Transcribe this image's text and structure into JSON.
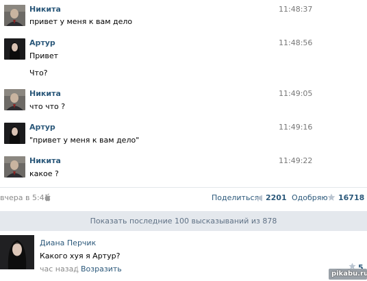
{
  "messages": [
    {
      "author": "Никита",
      "time": "11:48:37",
      "lines": [
        "привет у меня к вам дело"
      ],
      "avatar": "nikita"
    },
    {
      "author": "Артур",
      "time": "11:48:56",
      "lines": [
        "Привет",
        "Что?"
      ],
      "avatar": "artur"
    },
    {
      "author": "Никита",
      "time": "11:49:05",
      "lines": [
        "что что ?"
      ],
      "avatar": "nikita"
    },
    {
      "author": "Артур",
      "time": "11:49:16",
      "lines": [
        "\"привет у меня к вам дело\""
      ],
      "avatar": "artur"
    },
    {
      "author": "Никита",
      "time": "11:49:22",
      "lines": [
        "какое ?"
      ],
      "avatar": "nikita"
    }
  ],
  "post_meta": {
    "date": "вчера в 5:41",
    "date_icon": "apple-icon",
    "share_label": "Поделиться",
    "share_icon": "megaphone-icon",
    "share_count": "2201",
    "like_label": "Одобряю",
    "like_icon": "star-icon",
    "like_count": "16718"
  },
  "show_more": {
    "label": "Показать последние 100 высказываний из 878"
  },
  "comment": {
    "author": "Диана Перчик",
    "text": "Какого хуя я Артур?",
    "when": "час назад",
    "separator": "|",
    "reply_label": "Возразить",
    "like_icon": "star-icon",
    "like_count": "5"
  },
  "watermark": "pikabu.ru",
  "colors": {
    "link": "#2b587a",
    "muted": "#8a8a8a",
    "show_more_bg": "#e4e8ed",
    "show_more_text": "#5f7185"
  }
}
